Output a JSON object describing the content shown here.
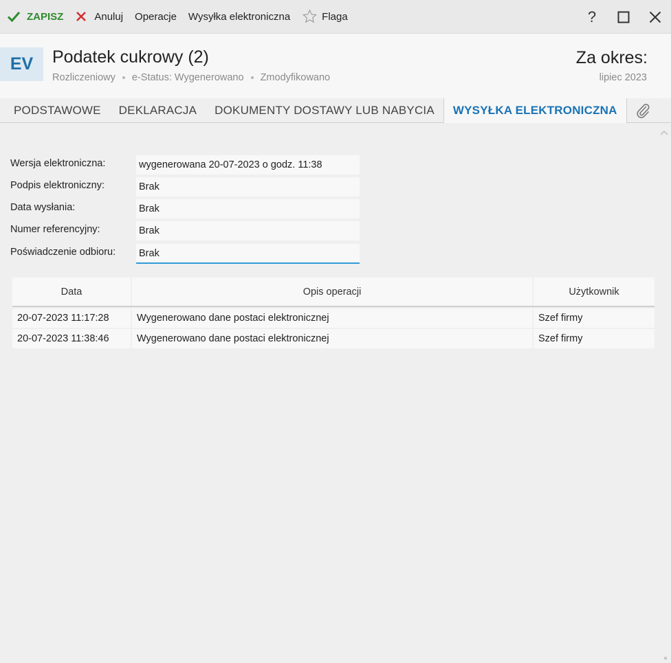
{
  "toolbar": {
    "save_label": "ZAPISZ",
    "cancel_label": "Anuluj",
    "operations_label": "Operacje",
    "send_label": "Wysyłka elektroniczna",
    "flag_label": "Flaga",
    "help_label": "?"
  },
  "header": {
    "badge": "EV",
    "title": "Podatek cukrowy (2)",
    "sub": [
      "Rozliczeniowy",
      "e-Status: Wygenerowano",
      "Zmodyfikowano"
    ],
    "period_label": "Za okres:",
    "period_value": "lipiec 2023"
  },
  "tabs": [
    {
      "label": "PODSTAWOWE"
    },
    {
      "label": "DEKLARACJA"
    },
    {
      "label": "DOKUMENTY DOSTAWY LUB NABYCIA"
    },
    {
      "label": "WYSYŁKA ELEKTRONICZNA",
      "active": true
    }
  ],
  "form": [
    {
      "label": "Wersja elektroniczna:",
      "value": "wygenerowana 20-07-2023 o godz. 11:38"
    },
    {
      "label": "Podpis elektroniczny:",
      "value": "Brak"
    },
    {
      "label": "Data wysłania:",
      "value": "Brak"
    },
    {
      "label": "Numer referencyjny:",
      "value": "Brak"
    },
    {
      "label": "Poświadczenie odbioru:",
      "value": "Brak"
    }
  ],
  "grid": {
    "columns": [
      "Data",
      "Opis operacji",
      "Użytkownik"
    ],
    "rows": [
      [
        "20-07-2023 11:17:28",
        "Wygenerowano dane postaci elektronicznej",
        "Szef firmy"
      ],
      [
        "20-07-2023 11:38:46",
        "Wygenerowano dane postaci elektronicznej",
        "Szef firmy"
      ]
    ]
  },
  "colors": {
    "save": "#2e8b2e",
    "cancel": "#d32f2f",
    "active_tab": "#1a73b5",
    "badge_bg": "#dce9f2",
    "focus_line": "#2f9bd8"
  }
}
